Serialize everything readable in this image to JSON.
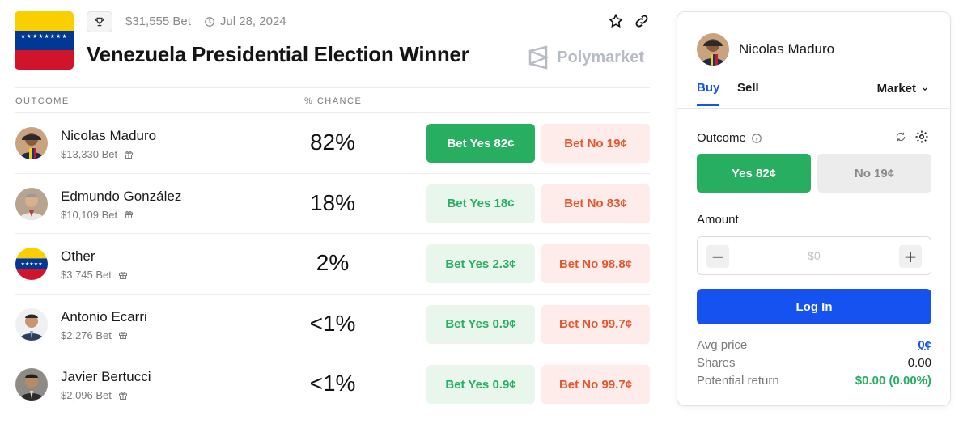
{
  "market": {
    "volume": "$31,555 Bet",
    "date": "Jul 28, 2024",
    "title": "Venezuela Presidential Election Winner",
    "brand": "Polymarket",
    "columns": {
      "outcome": "OUTCOME",
      "chance": "% CHANCE"
    },
    "outcomes": [
      {
        "name": "Nicolas Maduro",
        "volume": "$13,330 Bet",
        "chance": "82%",
        "yes": "Bet Yes 82¢",
        "no": "Bet No 19¢"
      },
      {
        "name": "Edmundo González",
        "volume": "$10,109 Bet",
        "chance": "18%",
        "yes": "Bet Yes 18¢",
        "no": "Bet No 83¢"
      },
      {
        "name": "Other",
        "volume": "$3,745 Bet",
        "chance": "2%",
        "yes": "Bet Yes 2.3¢",
        "no": "Bet No 98.8¢"
      },
      {
        "name": "Antonio Ecarri",
        "volume": "$2,276 Bet",
        "chance": "<1%",
        "yes": "Bet Yes 0.9¢",
        "no": "Bet No 99.7¢"
      },
      {
        "name": "Javier Bertucci",
        "volume": "$2,096 Bet",
        "chance": "<1%",
        "yes": "Bet Yes 0.9¢",
        "no": "Bet No 99.7¢"
      }
    ]
  },
  "panel": {
    "selected_name": "Nicolas Maduro",
    "tab_buy": "Buy",
    "tab_sell": "Sell",
    "order_type": "Market",
    "outcome_label": "Outcome",
    "yes_option": "Yes 82¢",
    "no_option": "No 19¢",
    "amount_label": "Amount",
    "amount_placeholder": "$0",
    "login_label": "Log In",
    "stats": [
      {
        "label": "Avg price",
        "value": "0¢"
      },
      {
        "label": "Shares",
        "value": "0.00"
      },
      {
        "label": "Potential return",
        "value": "$0.00 (0.00%)"
      }
    ]
  },
  "colors": {
    "green": "#27ae60",
    "red": "#e4572e",
    "blue": "#1652f0"
  }
}
